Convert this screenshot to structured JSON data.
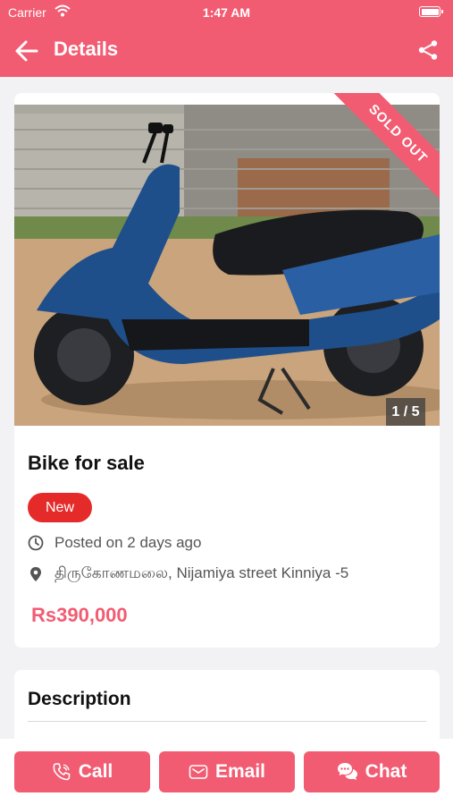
{
  "status_bar": {
    "carrier": "Carrier",
    "time": "1:47 AM"
  },
  "nav": {
    "title": "Details"
  },
  "listing": {
    "image_counter": "1 / 5",
    "ribbon": "SOLD OUT",
    "title": "Bike for sale",
    "condition_badge": "New",
    "posted": "Posted on 2 days ago",
    "location": "திருகோணமலை, Nijamiya street Kinniya -5",
    "price": "Rs390,000"
  },
  "description": {
    "heading": "Description"
  },
  "actions": {
    "call": "Call",
    "email": "Email",
    "chat": "Chat"
  },
  "colors": {
    "accent": "#f25c72",
    "badge": "#e52a2a"
  }
}
